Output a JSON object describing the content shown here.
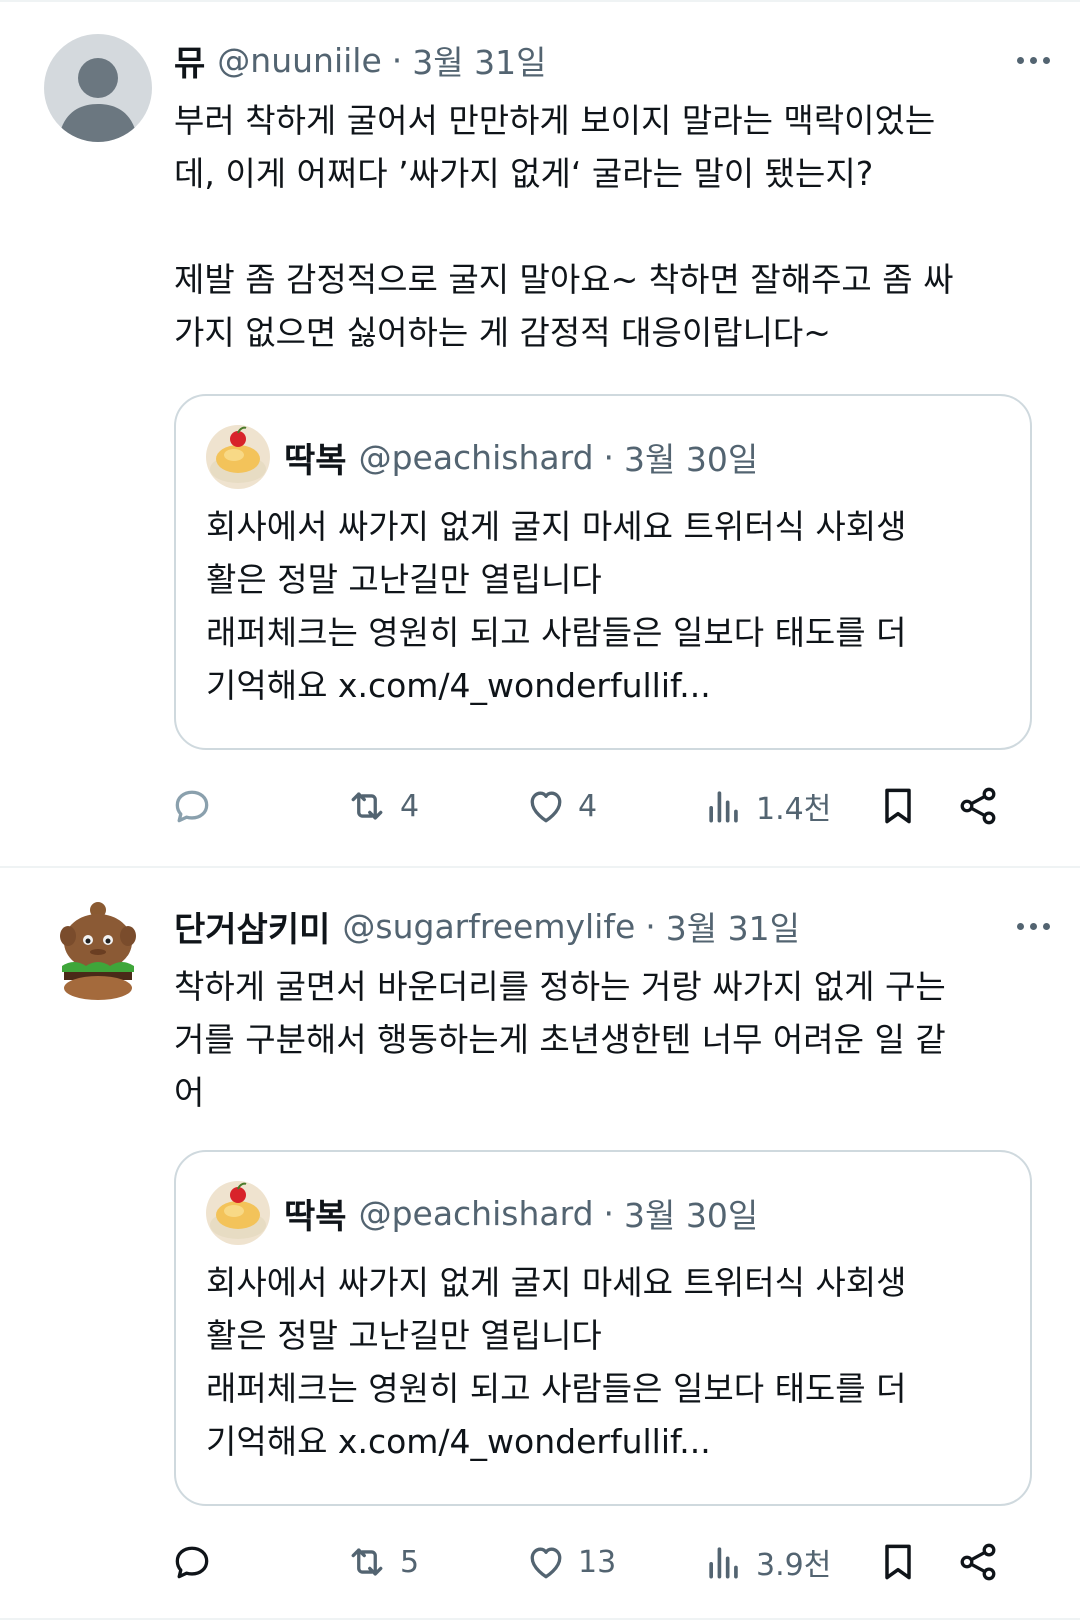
{
  "tweets": [
    {
      "author": {
        "name": "뮤",
        "handle": "@nuuniile"
      },
      "separator": "·",
      "date": "3월 31일",
      "text": "부러 착하게 굴어서 만만하게 보이지 말라는 맥락이었는\n데, 이게 어쩌다 ’싸가지 없게‘ 굴라는 말이 됐는지?\n\n제발 좀 감정적으로 굴지 말아요~ 착하면 잘해주고 좀 싸\n가지 없으면 싫어하는 게 감정적 대응이랍니다~",
      "quote": {
        "author": {
          "name": "딱복",
          "handle": "@peachishard"
        },
        "separator": "·",
        "date": "3월 30일",
        "text": "회사에서 싸가지 없게 굴지 마세요 트위터식 사회생\n활은 정말 고난길만 열립니다\n래퍼체크는 영원히 되고 사람들은 일보다 태도를 더\n기억해요 x.com/4_wonderfullif..."
      },
      "stats": {
        "replies": "",
        "retweets": "4",
        "likes": "4",
        "views": "1.4천"
      },
      "avatar_icon": "default-person-avatar-icon"
    },
    {
      "author": {
        "name": "단거삼키미",
        "handle": "@sugarfreemylife"
      },
      "separator": "·",
      "date": "3월 31일",
      "text": "착하게 굴면서 바운더리를 정하는 거랑 싸가지 없게 구는\n거를 구분해서 행동하는게 초년생한텐 너무 어려운 일 같\n어",
      "quote": {
        "author": {
          "name": "딱복",
          "handle": "@peachishard"
        },
        "separator": "·",
        "date": "3월 30일",
        "text": "회사에서 싸가지 없게 굴지 마세요 트위터식 사회생\n활은 정말 고난길만 열립니다\n래퍼체크는 영원히 되고 사람들은 일보다 태도를 더\n기억해요 x.com/4_wonderfullif..."
      },
      "stats": {
        "replies": "",
        "retweets": "5",
        "likes": "13",
        "views": "3.9천"
      },
      "avatar_icon": "burger-plush-avatar-icon"
    }
  ],
  "icons": {
    "reply": "reply-icon",
    "retweet": "retweet-icon",
    "like": "heart-icon",
    "views": "views-chart-icon",
    "bookmark": "bookmark-icon",
    "share": "share-icon",
    "more": "more-dots-icon"
  },
  "colors": {
    "text": "#0f1419",
    "secondary": "#536471",
    "border": "#cfd9de",
    "divider": "#eff3f4"
  }
}
